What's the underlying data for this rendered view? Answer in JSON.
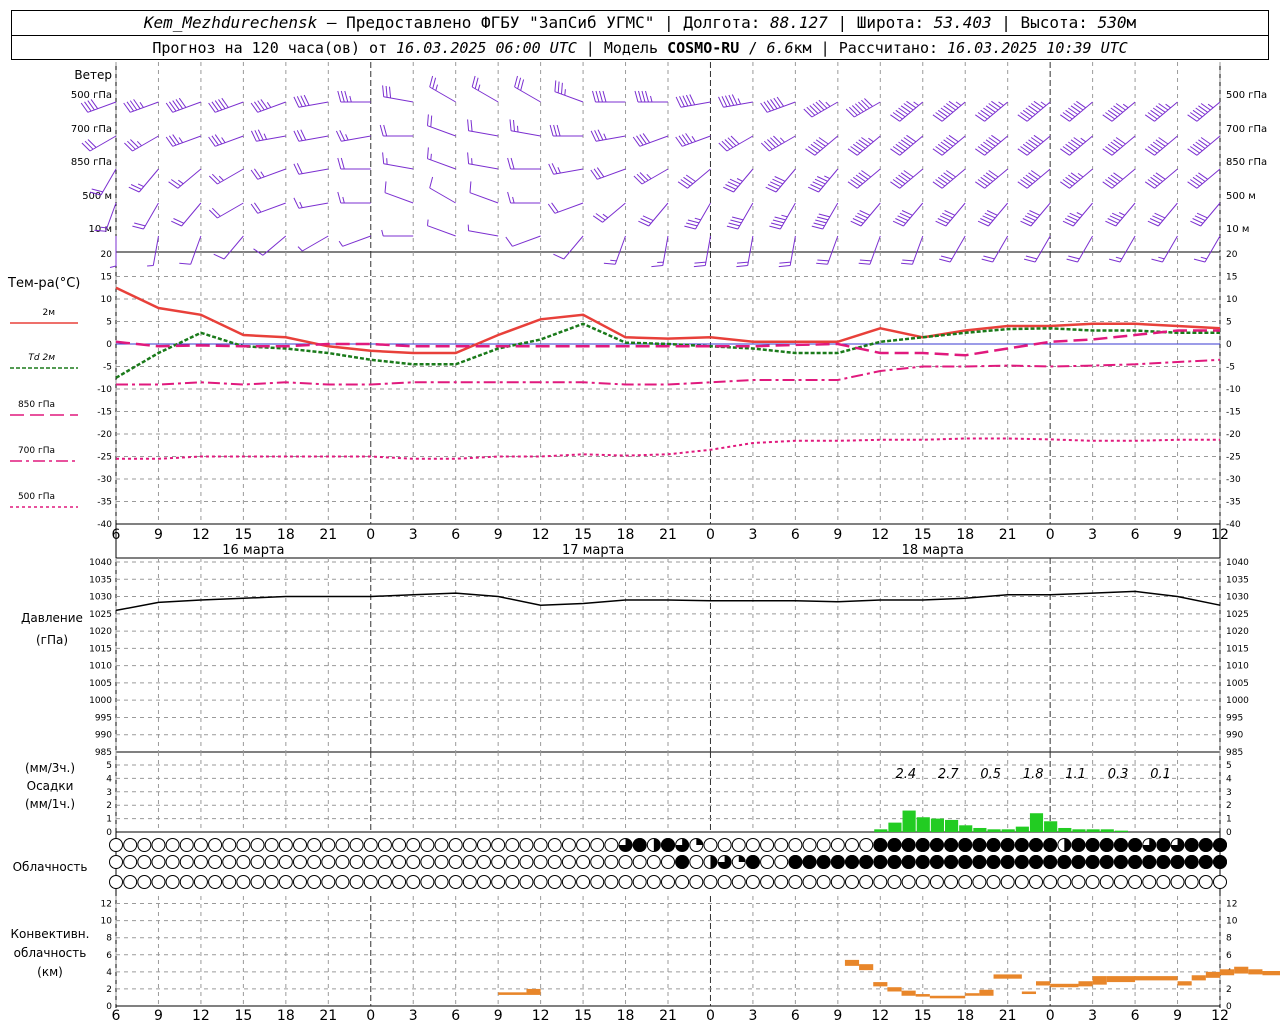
{
  "header": {
    "station": "Kem_Mezhdurechensk",
    "provided": "— Предоставлено ФГБУ \"ЗапСиб УГМС\"",
    "lon_label": "Долгота:",
    "lon": "88.127",
    "lat_label": "Широта:",
    "lat": "53.403",
    "alt_label": "Высота:",
    "alt": "530",
    "alt_unit": "м",
    "forecast_label": "Прогноз на 120 часа(ов) от",
    "start": "16.03.2025 06:00 UTC",
    "model_label": "Модель",
    "model": "COSMO-RU",
    "res": "6.6",
    "res_unit": "км",
    "calc_label": "Рассчитано:",
    "calc": "16.03.2025 10:39 UTC"
  },
  "labels": {
    "wind": "Ветер",
    "wind_levels": [
      "500 гПа",
      "700 гПа",
      "850 гПа",
      "500 м",
      "10  м"
    ],
    "temp": "Тем-ра(°C)",
    "temp_legend": [
      {
        "label": "2м",
        "color": "#e8403a",
        "dash": ""
      },
      {
        "label": "Td 2м",
        "color": "#1a7a1a",
        "dash": "4,2"
      },
      {
        "label": "850 гПа",
        "color": "#e0197d",
        "dash": "14,6"
      },
      {
        "label": "700 гПа",
        "color": "#e0197d",
        "dash": "12,4,3,4"
      },
      {
        "label": "500 гПа",
        "color": "#e0197d",
        "dash": "3,3"
      }
    ],
    "pressure": "Давление",
    "pressure_unit": "(гПа)",
    "precip_unit1": "(мм/3ч.)",
    "precip": "Осадки",
    "precip_unit2": "(мм/1ч.)",
    "cloud": "Облачность",
    "conv1": "Конвективн.",
    "conv2": "облачность",
    "conv3": "(км)",
    "days": [
      "16 марта",
      "17 марта",
      "18 марта"
    ],
    "hour_ticks": [
      "6",
      "9",
      "12",
      "15",
      "18",
      "21",
      "0",
      "3",
      "6",
      "9",
      "12",
      "15",
      "18",
      "21",
      "0",
      "3",
      "6",
      "9",
      "12",
      "15",
      "18",
      "21",
      "0",
      "3",
      "6",
      "9",
      "12"
    ]
  },
  "chart_data": [
    {
      "type": "line",
      "panel": "temperature",
      "ylabel": "Тем-ра(°C)",
      "ylim": [
        -40,
        20
      ],
      "x_unit": "hours from 16.03 06 UTC",
      "x": [
        0,
        3,
        6,
        9,
        12,
        15,
        18,
        21,
        24,
        27,
        30,
        33,
        36,
        39,
        42,
        45,
        48,
        51,
        54,
        57,
        60,
        63,
        66,
        69,
        72,
        75,
        78
      ],
      "series": [
        {
          "name": "2м",
          "values": [
            12.5,
            8,
            6.5,
            2,
            1.5,
            -0.5,
            -1.5,
            -2,
            -2,
            2,
            5.5,
            6.5,
            1.5,
            1.2,
            1.5,
            0.5,
            0.5,
            0.5,
            3.5,
            1.5,
            3,
            4,
            4,
            4.5,
            4.5,
            4,
            3.5
          ]
        },
        {
          "name": "Td 2м",
          "values": [
            -7.5,
            -2,
            2.5,
            -0.5,
            -1,
            -2,
            -3.5,
            -4.5,
            -4.5,
            -1,
            1,
            4.5,
            0.3,
            0,
            -0.5,
            -1,
            -2,
            -2,
            0.5,
            1.5,
            2.5,
            3.3,
            3.5,
            3,
            3,
            2.5,
            2.5
          ]
        },
        {
          "name": "850 гПа",
          "values": [
            0.5,
            -0.5,
            -0.3,
            -0.5,
            -0.5,
            0,
            0,
            -0.5,
            -0.5,
            -0.5,
            -0.5,
            -0.5,
            -0.5,
            -0.5,
            -0.5,
            -0.5,
            -0.2,
            0,
            -2,
            -2,
            -2.5,
            -1,
            0.5,
            1,
            2,
            3,
            3
          ]
        },
        {
          "name": "700 гПа",
          "values": [
            -9,
            -9,
            -8.5,
            -9,
            -8.5,
            -9,
            -9,
            -8.5,
            -8.5,
            -8.5,
            -8.5,
            -8.5,
            -9,
            -9,
            -8.5,
            -8,
            -8,
            -8,
            -6,
            -5,
            -5,
            -4.8,
            -5,
            -4.8,
            -4.5,
            -4,
            -3.5
          ]
        },
        {
          "name": "500 гПа",
          "values": [
            -25.5,
            -25.5,
            -25,
            -25,
            -25,
            -25,
            -25,
            -25.5,
            -25.5,
            -25,
            -25,
            -24.5,
            -24.8,
            -24.5,
            -23.5,
            -22,
            -21.5,
            -21.5,
            -21.3,
            -21.3,
            -21,
            -21,
            -21.2,
            -21.5,
            -21.5,
            -21.3,
            -21.3
          ]
        }
      ]
    },
    {
      "type": "line",
      "panel": "pressure",
      "ylabel": "Давление (гПа)",
      "ylim": [
        985,
        1040
      ],
      "x": [
        0,
        3,
        6,
        9,
        12,
        15,
        18,
        21,
        24,
        27,
        30,
        33,
        36,
        39,
        42,
        45,
        48,
        51,
        54,
        57,
        60,
        63,
        66,
        69,
        72,
        75,
        78
      ],
      "series": [
        {
          "name": "",
          "values": [
            1026,
            1028.3,
            1029,
            1029.5,
            1030,
            1030,
            1030,
            1030.5,
            1031,
            1030,
            1027.5,
            1028,
            1029,
            1029,
            1028.8,
            1028.8,
            1028.8,
            1028.5,
            1029,
            1029,
            1029.5,
            1030.5,
            1030.5,
            1031,
            1031.5,
            1030,
            1027.5
          ]
        }
      ]
    },
    {
      "type": "bar",
      "panel": "precipitation",
      "ylabel": "Осадки (мм/1ч.)",
      "ylim": [
        0,
        5
      ],
      "x_start": 54,
      "values_hourly": [
        0.2,
        0.7,
        1.6,
        1.1,
        1.0,
        0.9,
        0.5,
        0.3,
        0.2,
        0.2,
        0.4,
        1.4,
        0.8,
        0.3,
        0.2,
        0.2,
        0.2,
        0.1
      ],
      "totals_3h": [
        {
          "hour": "5",
          "value": "2.4"
        },
        {
          "hour": "8",
          "value": "2.7"
        },
        {
          "hour": "11",
          "value": "0.5"
        },
        {
          "hour": "14",
          "value": "1.8"
        },
        {
          "hour": "17",
          "value": "1.1"
        },
        {
          "hour": "20",
          "value": "0.3"
        },
        {
          "hour": "23",
          "value": "0.1"
        }
      ]
    },
    {
      "type": "table",
      "panel": "cloudiness",
      "rows_from_x": 0,
      "row_high": "000000000000000000000000000000000000342431000000000000444444444444424444434344433333333432323444433431",
      "row_mid": "000000000000000000000000000000000000000040231400444444444444444444444444444444444444444444444444444444",
      "row_low": "000000000000000000000000000000000000000000000000000000000000000000000000000000000000000000000000000000"
    },
    {
      "type": "bar",
      "panel": "convective_cloud",
      "ylabel": "Конвективн. облачность (км)",
      "ylim": [
        0,
        13
      ],
      "segments": [
        {
          "x0": 27.0,
          "x1": 29.0,
          "lo": 1.3,
          "hi": 1.6
        },
        {
          "x0": 29.0,
          "x1": 30.0,
          "lo": 1.3,
          "hi": 2.0
        },
        {
          "x0": 51.5,
          "x1": 52.5,
          "lo": 4.7,
          "hi": 5.4
        },
        {
          "x0": 52.5,
          "x1": 53.5,
          "lo": 4.2,
          "hi": 4.9
        },
        {
          "x0": 53.5,
          "x1": 54.5,
          "lo": 2.3,
          "hi": 2.8
        },
        {
          "x0": 54.5,
          "x1": 55.5,
          "lo": 1.7,
          "hi": 2.2
        },
        {
          "x0": 55.5,
          "x1": 56.5,
          "lo": 1.2,
          "hi": 1.8
        },
        {
          "x0": 56.5,
          "x1": 57.5,
          "lo": 1.1,
          "hi": 1.4
        },
        {
          "x0": 57.5,
          "x1": 60.0,
          "lo": 0.9,
          "hi": 1.2
        },
        {
          "x0": 60.0,
          "x1": 61.0,
          "lo": 1.2,
          "hi": 1.5
        },
        {
          "x0": 61.0,
          "x1": 62.0,
          "lo": 1.2,
          "hi": 1.9
        },
        {
          "x0": 62.0,
          "x1": 64.0,
          "lo": 3.2,
          "hi": 3.7
        },
        {
          "x0": 64.0,
          "x1": 65.0,
          "lo": 1.4,
          "hi": 1.7
        },
        {
          "x0": 65.0,
          "x1": 66.0,
          "lo": 2.4,
          "hi": 2.9
        },
        {
          "x0": 66.0,
          "x1": 68.0,
          "lo": 2.2,
          "hi": 2.6
        },
        {
          "x0": 68.0,
          "x1": 69.0,
          "lo": 2.3,
          "hi": 2.9
        },
        {
          "x0": 69.0,
          "x1": 70.0,
          "lo": 2.5,
          "hi": 3.5
        },
        {
          "x0": 70.0,
          "x1": 72.0,
          "lo": 2.8,
          "hi": 3.5
        },
        {
          "x0": 72.0,
          "x1": 75.0,
          "lo": 3.0,
          "hi": 3.5
        },
        {
          "x0": 75.0,
          "x1": 76.0,
          "lo": 2.4,
          "hi": 2.9
        },
        {
          "x0": 76.0,
          "x1": 77.0,
          "lo": 3.0,
          "hi": 3.6
        },
        {
          "x0": 77.0,
          "x1": 78.0,
          "lo": 3.3,
          "hi": 4.0
        },
        {
          "x0": 78.0,
          "x1": 79.0,
          "lo": 3.6,
          "hi": 4.3
        },
        {
          "x0": 79.0,
          "x1": 80.0,
          "lo": 3.8,
          "hi": 4.6
        },
        {
          "x0": 80.0,
          "x1": 81.0,
          "lo": 3.7,
          "hi": 4.3
        },
        {
          "x0": 81.0,
          "x1": 83.0,
          "lo": 3.6,
          "hi": 4.1
        }
      ]
    },
    {
      "type": "scatter",
      "panel": "wind_barbs",
      "levels": [
        "500 гПа",
        "700 гПа",
        "850 гПа",
        "500 м",
        "10  м"
      ],
      "dir_deg": [
        [
          250,
          250,
          250,
          250,
          250,
          260,
          270,
          280,
          300,
          300,
          300,
          290,
          270,
          270,
          260,
          260,
          250,
          240,
          240,
          230,
          230,
          230,
          230,
          230,
          230,
          230,
          230
        ],
        [
          240,
          240,
          250,
          250,
          260,
          260,
          260,
          270,
          290,
          280,
          280,
          270,
          260,
          250,
          250,
          240,
          240,
          230,
          230,
          230,
          230,
          230,
          230,
          230,
          230,
          230,
          230
        ],
        [
          210,
          220,
          230,
          240,
          250,
          260,
          270,
          280,
          290,
          280,
          270,
          260,
          250,
          240,
          230,
          220,
          220,
          220,
          230,
          230,
          230,
          230,
          230,
          230,
          230,
          230,
          230
        ],
        [
          200,
          210,
          220,
          240,
          250,
          260,
          270,
          290,
          300,
          290,
          270,
          250,
          230,
          220,
          210,
          210,
          210,
          210,
          220,
          220,
          220,
          220,
          220,
          220,
          220,
          220,
          220
        ],
        [
          180,
          190,
          200,
          220,
          230,
          240,
          250,
          270,
          290,
          280,
          250,
          220,
          200,
          190,
          190,
          190,
          190,
          200,
          200,
          200,
          210,
          210,
          210,
          210,
          210,
          210,
          210
        ]
      ],
      "speed_ms": [
        [
          16,
          18,
          20,
          20,
          18,
          16,
          14,
          12,
          10,
          10,
          12,
          14,
          16,
          18,
          20,
          22,
          24,
          26,
          28,
          30,
          30,
          30,
          30,
          28,
          26,
          26,
          26
        ],
        [
          12,
          14,
          14,
          14,
          14,
          12,
          10,
          8,
          8,
          8,
          10,
          12,
          14,
          16,
          18,
          20,
          22,
          24,
          26,
          28,
          28,
          28,
          28,
          26,
          24,
          24,
          24
        ],
        [
          8,
          10,
          10,
          10,
          10,
          8,
          8,
          6,
          6,
          6,
          8,
          10,
          12,
          14,
          16,
          18,
          20,
          22,
          24,
          24,
          24,
          24,
          24,
          22,
          20,
          20,
          20
        ],
        [
          6,
          8,
          8,
          8,
          8,
          6,
          6,
          5,
          5,
          5,
          6,
          8,
          10,
          12,
          14,
          16,
          18,
          20,
          20,
          20,
          20,
          20,
          20,
          18,
          18,
          16,
          16
        ],
        [
          3,
          3,
          4,
          4,
          4,
          3,
          3,
          3,
          3,
          3,
          4,
          5,
          6,
          7,
          8,
          8,
          8,
          8,
          8,
          8,
          8,
          8,
          8,
          8,
          7,
          7,
          7
        ]
      ]
    }
  ],
  "colors": {
    "t2m": "#e8403a",
    "td": "#1a7a1a",
    "upper": "#e0197d",
    "pressure": "#000000",
    "precip": "#22cc22",
    "precip_dark": "#1a3fbf",
    "conv": "#e8862a",
    "wind": "#7b2fd0",
    "grid": "#9a9a9a"
  }
}
